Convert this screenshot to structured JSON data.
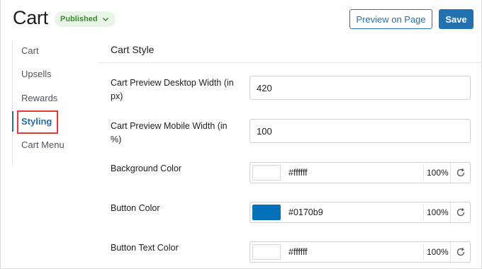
{
  "header": {
    "title": "Cart",
    "status": "Published",
    "preview_label": "Preview on Page",
    "save_label": "Save"
  },
  "sidebar": {
    "items": [
      {
        "label": "Cart",
        "active": false
      },
      {
        "label": "Upsells",
        "active": false
      },
      {
        "label": "Rewards",
        "active": false
      },
      {
        "label": "Styling",
        "active": true
      },
      {
        "label": "Cart Menu",
        "active": false
      }
    ]
  },
  "main": {
    "section_title": "Cart Style",
    "desktop_width": {
      "label": "Cart Preview Desktop Width (in px)",
      "value": "420"
    },
    "mobile_width": {
      "label": "Cart Preview Mobile Width (in %)",
      "value": "100"
    },
    "background_color": {
      "label": "Background Color",
      "hex": "#ffffff",
      "opacity": "100%"
    },
    "button_color": {
      "label": "Button Color",
      "hex": "#0170b9",
      "opacity": "100%"
    },
    "button_text_color": {
      "label": "Button Text Color",
      "hex": "#ffffff",
      "opacity": "100%"
    }
  },
  "colors": {
    "accent": "#2271b1",
    "published_bg": "#e9f6e7",
    "published_text": "#3a8a2e",
    "highlight": "#e53935",
    "swatch_button": "#0170b9"
  }
}
